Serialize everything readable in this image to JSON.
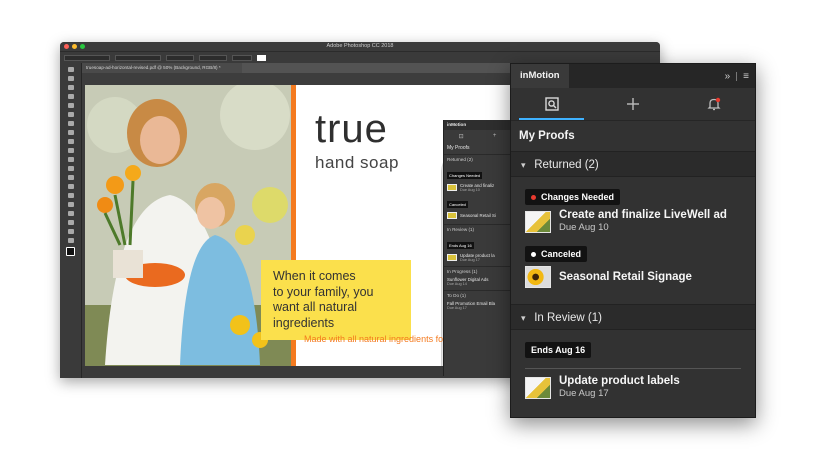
{
  "photoshop": {
    "title": "Adobe Photoshop CC 2018",
    "document_tab": "truesoap-ad-horizontal-revised.pdf @ 50% (Background, RGB/8) *",
    "ad": {
      "brand": "true",
      "brand_sub": "hand soap",
      "headline": [
        "When it comes",
        "to your family, you",
        "want all natural",
        "ingredients"
      ],
      "footer": "Made with all natural ingredients fo"
    },
    "mini_panel": {
      "header": "inMotion",
      "title": "My Proofs",
      "returned": "Returned (2)",
      "changes_needed": "Changes Needed",
      "proof1": "Create and finaliz",
      "proof1_due": "Due Aug 10",
      "canceled": "Canceled",
      "proof2": "Seasonal Retail Si",
      "in_review": "In Review (1)",
      "ends": "Ends Aug 16",
      "proof3": "Update product la",
      "proof3_due": "Due Aug 17",
      "in_progress": "In Progress (1)",
      "proof4": "Sunflower Digital Ads",
      "proof4_due": "Due Aug 14",
      "to_do": "To Do (1)",
      "proof5": "Fall Promotion Email Bla",
      "proof5_due": "Due Aug 17"
    }
  },
  "panel": {
    "tab_label": "inMotion",
    "section_title": "My Proofs",
    "groups": [
      {
        "label": "Returned (2)",
        "items": [
          {
            "badge": "Changes Needed",
            "name": "Create and finalize LiveWell ad",
            "due": "Due Aug 10"
          },
          {
            "badge": "Canceled",
            "name": "Seasonal Retail Signage",
            "due": ""
          }
        ]
      },
      {
        "label": "In Review (1)",
        "items": [
          {
            "badge": "Ends Aug 16",
            "name": "Update product labels",
            "due": "Due Aug 17"
          }
        ]
      }
    ]
  },
  "colors": {
    "accent_blue": "#3fb2ff",
    "changes_needed_dot": "#e83a2f",
    "orange": "#f47a1f",
    "headline_yellow": "#fbe04c"
  },
  "icons": [
    "proofs-search-icon",
    "add-icon",
    "notification-bell-icon",
    "expand-icon",
    "menu-icon",
    "chevron-down-icon"
  ]
}
